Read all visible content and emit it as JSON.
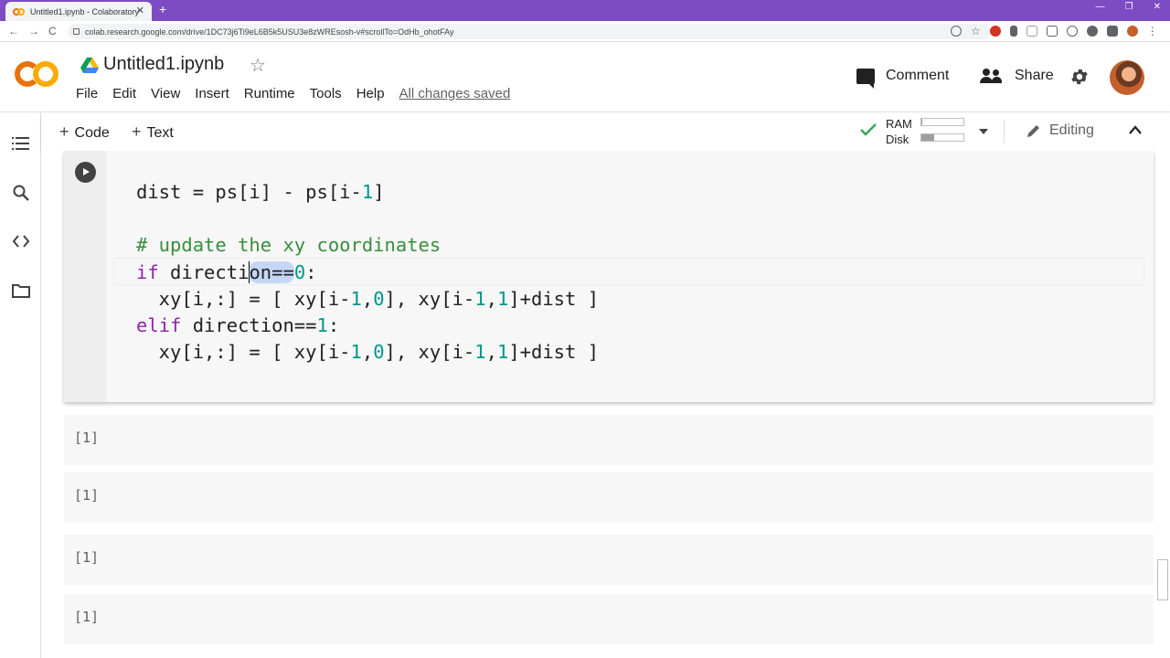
{
  "browser": {
    "tab_title": "Untitled1.ipynb - Colaboratory",
    "tab_close": "✕",
    "new_tab": "+",
    "url": "colab.research.google.com/drive/1DC73j6Ti9eL6B5k5USU3e8zWREsosh-v#scrollTo=OdHb_ohotFAy",
    "nav_back": "←",
    "nav_forward": "→",
    "nav_reload": "C",
    "window_controls": [
      "—",
      "❐",
      "✕"
    ]
  },
  "header": {
    "title": "Untitled1.ipynb",
    "star": "☆",
    "menu": [
      "File",
      "Edit",
      "View",
      "Insert",
      "Runtime",
      "Tools",
      "Help"
    ],
    "save_status": "All changes saved",
    "comment_label": "Comment",
    "share_label": "Share"
  },
  "toolbar": {
    "add_code_label": "Code",
    "add_text_label": "Text",
    "plus": "+",
    "ram_label": "RAM",
    "disk_label": "Disk",
    "ram_usage": 0.03,
    "disk_usage": 0.3,
    "editing_label": "Editing"
  },
  "colors": {
    "tab_strip": "#7d4bc2",
    "keyword": "#8e24aa",
    "number": "#009688",
    "comment": "#388e3c",
    "logo_orange": "#e8710a",
    "logo_yellow": "#f9ab00"
  },
  "active_cell": {
    "lines": [
      "dist = ps[i] - ps[i-1]",
      "",
      "# update the xy coordinates",
      "if direction==0:",
      "  xy[i,:] = [ xy[i-1,0], xy[i-1,1]+dist ]",
      "elif direction==1:",
      "  xy[i,:] = [ xy[i-1,0], xy[i-1,1]+dist ]"
    ],
    "tokens": {
      "l1_a": "dist = ps[i] - ps[i-",
      "l1_n": "1",
      "l1_b": "]",
      "comment": "# update the xy coordinates",
      "if_kw": "if",
      "if_a": " directi",
      "if_b": "on",
      "if_op": "==",
      "if_n": "0",
      "if_c": ":",
      "x1_a": "  xy[i,:] = [ xy[i-",
      "x1_n1": "1",
      "x1_b": ",",
      "x1_n2": "0",
      "x1_c": "], xy[i-",
      "x1_n3": "1",
      "x1_d": ",",
      "x1_n4": "1",
      "x1_e": "]+dist ]",
      "elif_kw": "elif",
      "elif_a": " direction==",
      "elif_n": "1",
      "elif_c": ":"
    }
  },
  "output_cells": [
    "[1]",
    "[1]",
    "[1]",
    "[1]"
  ]
}
